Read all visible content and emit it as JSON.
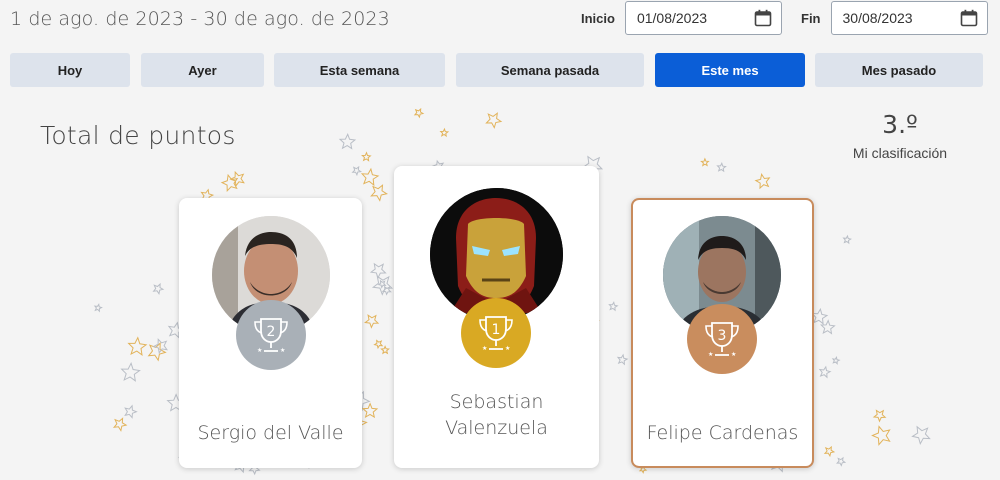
{
  "header": {
    "range_text": "1 de ago. de 2023 - 30 de ago. de 2023",
    "start_label": "Inicio",
    "start_value": "01/08/2023",
    "end_label": "Fin",
    "end_value": "30/08/2023"
  },
  "periods": [
    {
      "label": "Hoy",
      "active": false
    },
    {
      "label": "Ayer",
      "active": false
    },
    {
      "label": "Esta semana",
      "active": false
    },
    {
      "label": "Semana pasada",
      "active": false
    },
    {
      "label": "Este mes",
      "active": true
    },
    {
      "label": "Mes pasado",
      "active": false
    }
  ],
  "section_title": "Total de puntos",
  "my_rank": {
    "value": "3.º",
    "label": "Mi clasificación"
  },
  "podium": [
    {
      "place": "2",
      "name": "Sergio del Valle",
      "medal_color": "#a9b0b7"
    },
    {
      "place": "1",
      "name_line1": "Sebastian",
      "name_line2": "Valenzuela",
      "medal_color": "#d9a923"
    },
    {
      "place": "3",
      "name": "Felipe Cardenas",
      "medal_color": "#c98d5e",
      "is_me": true
    }
  ],
  "colors": {
    "accent": "#0b5ed7",
    "button": "#dde3ec",
    "star_gold": "#e2b35a",
    "star_gray": "#b9bec6"
  }
}
